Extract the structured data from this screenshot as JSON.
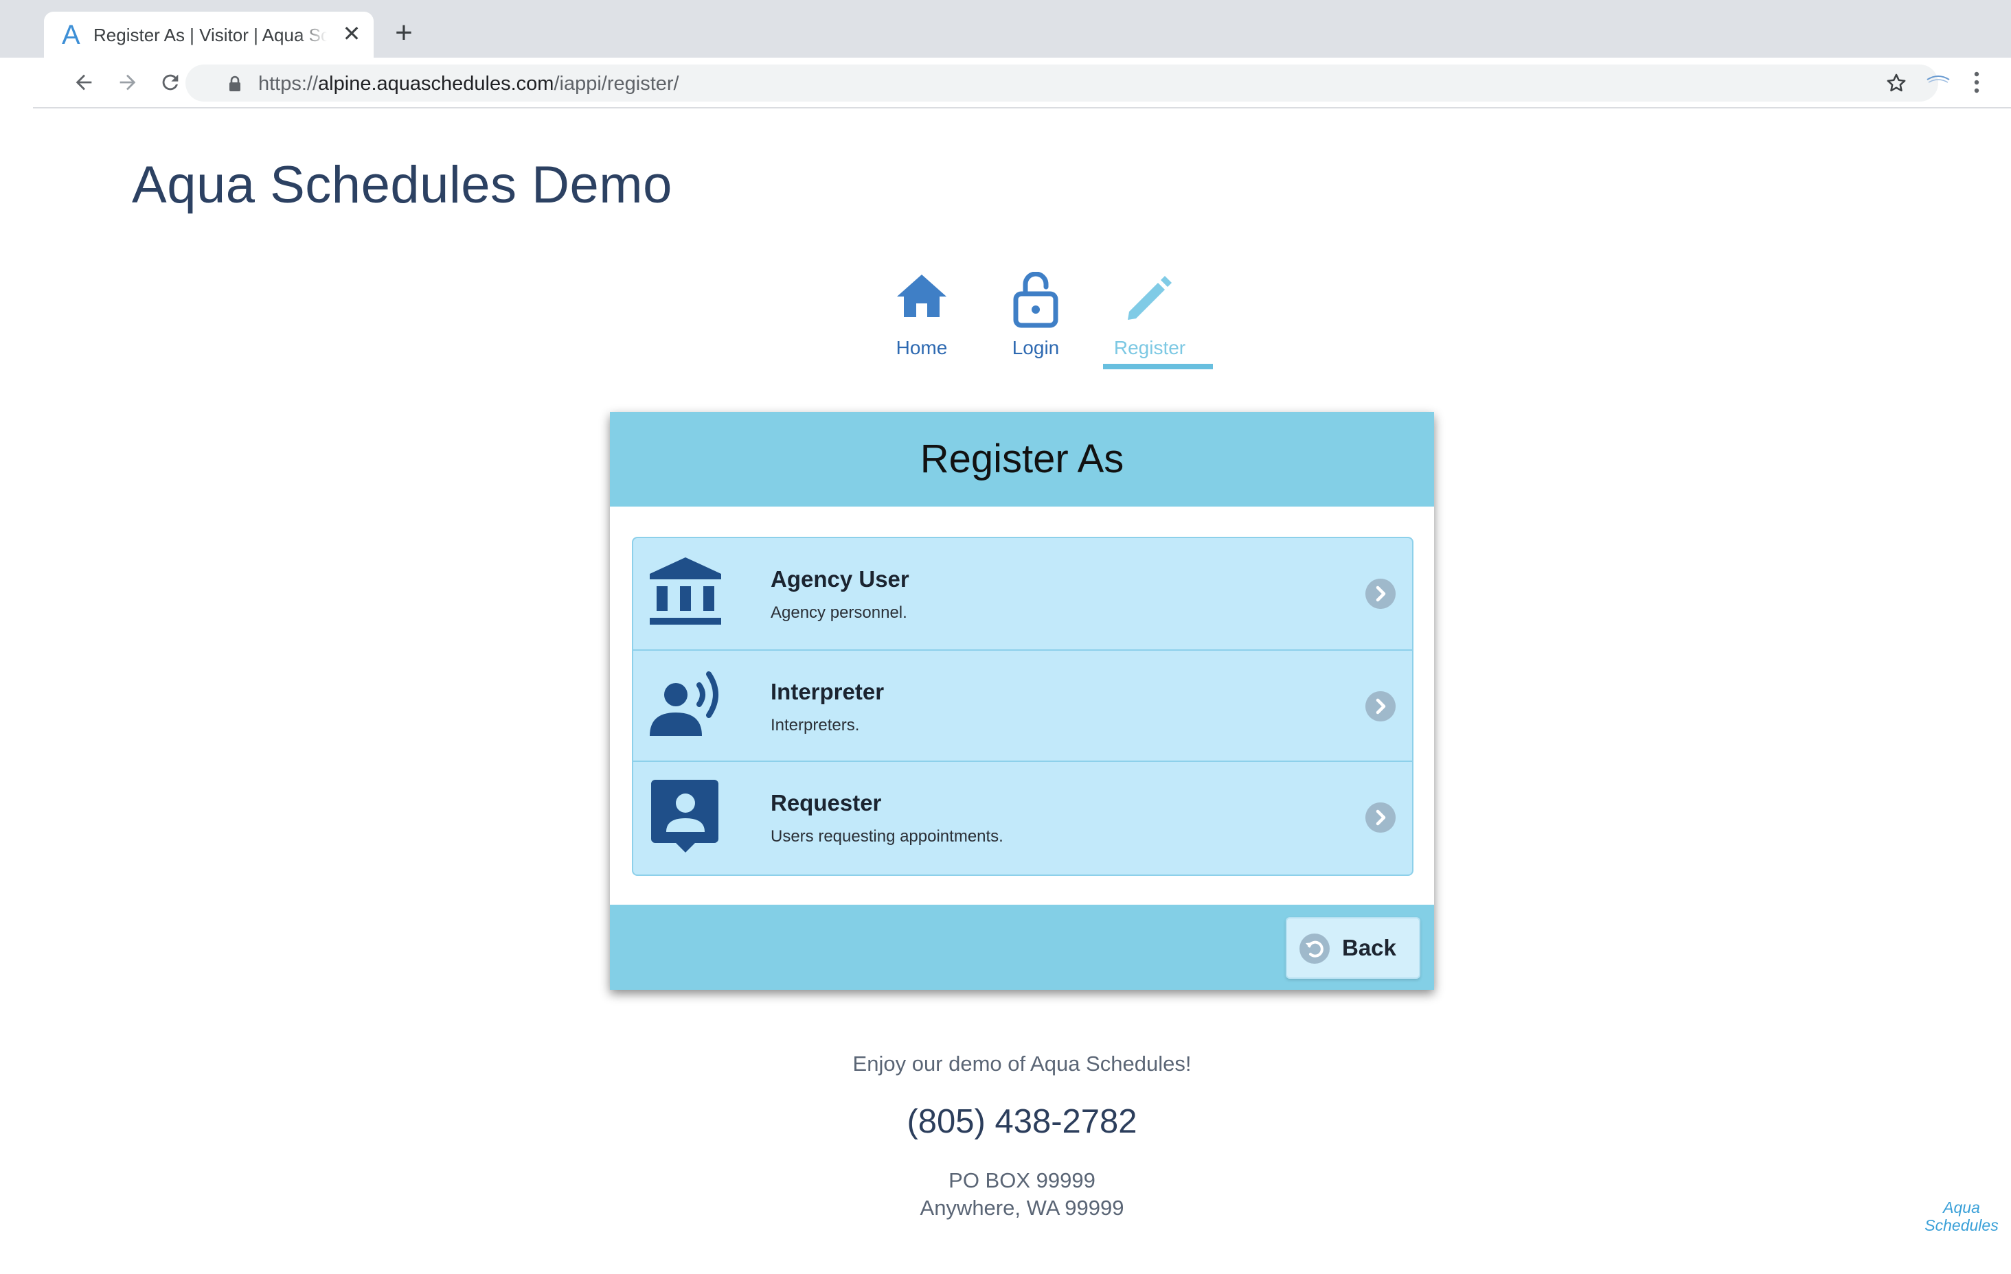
{
  "browser": {
    "tab_favicon": "A",
    "tab_title": "Register As | Visitor | Aqua Schedules",
    "tab_close": "✕",
    "new_tab": "+",
    "url_scheme": "https://",
    "url_host": "alpine.aquaschedules.com",
    "url_path": "/iappi/register/",
    "icons": [
      "back-arrow-icon",
      "forward-arrow-icon",
      "reload-icon",
      "lock-icon",
      "star-icon",
      "extension-icon",
      "menu-dots-icon"
    ]
  },
  "site": {
    "title": "Aqua Schedules Demo"
  },
  "nav": {
    "items": [
      {
        "label": "Home",
        "icon": "home-icon"
      },
      {
        "label": "Login",
        "icon": "lock-open-icon"
      },
      {
        "label": "Register",
        "icon": "pencil-icon",
        "active": true
      }
    ],
    "colors": {
      "active": "#7cc8e3",
      "default": "#2d69b1"
    }
  },
  "card": {
    "title": "Register As",
    "options": [
      {
        "name": "Agency User",
        "desc": "Agency personnel.",
        "icon": "bank-icon"
      },
      {
        "name": "Interpreter",
        "desc": "Interpreters.",
        "icon": "speaking-person-icon"
      },
      {
        "name": "Requester",
        "desc": "Users requesting appointments.",
        "icon": "contact-card-icon"
      }
    ],
    "back_label": "Back",
    "colors": {
      "header": "#83cfe6",
      "list": "#c2e9fa",
      "icon": "#1f4f89"
    }
  },
  "footer": {
    "enjoy": "Enjoy our demo of Aqua Schedules!",
    "phone": "(805) 438-2782",
    "address1": "PO BOX 99999",
    "address2": "Anywhere, WA 99999"
  },
  "corner_logo": {
    "line1": "Aqua",
    "line2": "Schedules"
  }
}
